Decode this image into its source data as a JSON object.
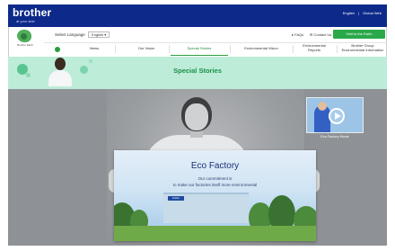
{
  "header": {
    "logo": "brother",
    "logo_tagline": "at your side",
    "top_links": [
      "English",
      "Global Web"
    ]
  },
  "util": {
    "emblem_caption": "Brother Earth",
    "language_label": "Select Language",
    "language_value": "English",
    "faq": "FAQs",
    "contact": "Contact Us",
    "cta": "Visit to the Earth"
  },
  "nav": {
    "items": [
      "News",
      "Our Vision",
      "Special Stories",
      "Environmental Vision",
      "Environmental Reports",
      "Brother Group Environmental Information"
    ],
    "active": "Special Stories"
  },
  "banner": {
    "title": "Special Stories",
    "colors": {
      "background": "#bdecd9",
      "title": "#1a9146"
    }
  },
  "feature": {
    "title": "Eco Factory",
    "line1": "Our commitment is",
    "line2": "to make our factories itself more environmental",
    "sign": "brother"
  },
  "video": {
    "caption": "Eco Factory Movie",
    "icon": "play-icon"
  },
  "colors": {
    "brand": "#0d2a8a",
    "accent": "#2aa84a"
  }
}
